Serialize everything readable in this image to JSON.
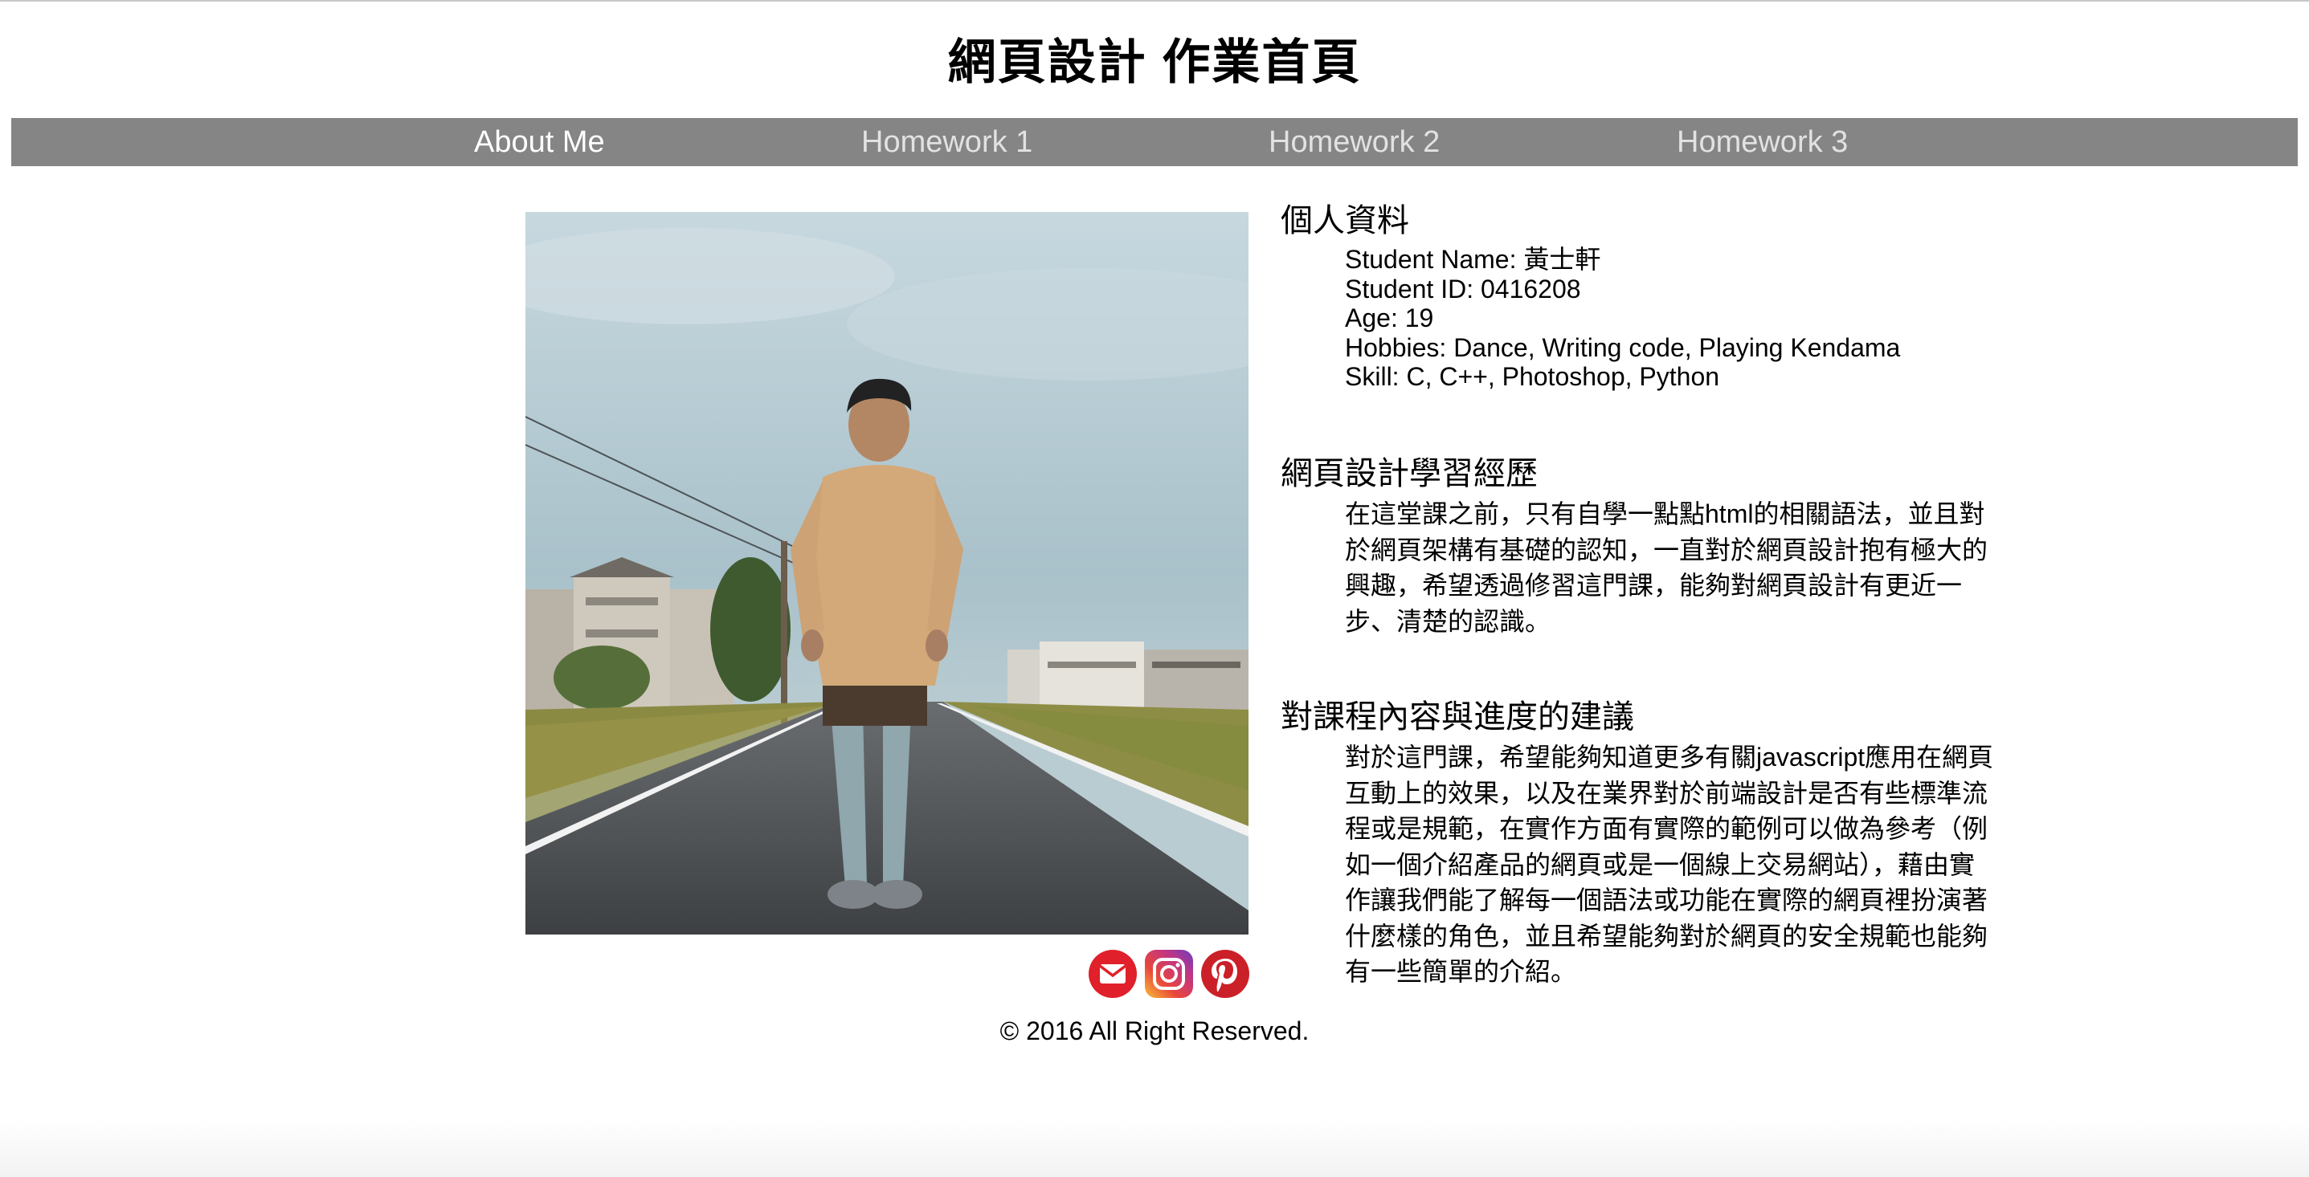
{
  "header": {
    "title": "網頁設計 作業首頁"
  },
  "nav": {
    "items": [
      {
        "label": "About Me",
        "active": true
      },
      {
        "label": "Homework 1",
        "active": false
      },
      {
        "label": "Homework 2",
        "active": false
      },
      {
        "label": "Homework 3",
        "active": false
      }
    ]
  },
  "profile_photo": {
    "icon": "profile-photo"
  },
  "social": [
    {
      "icon": "mail-icon",
      "color": "#e0202a"
    },
    {
      "icon": "instagram-icon",
      "color": "#c13584"
    },
    {
      "icon": "pinterest-icon",
      "color": "#cb2027"
    }
  ],
  "personal": {
    "heading": "個人資料",
    "lines": [
      "Student Name: 黃士軒",
      "Student ID: 0416208",
      "Age: 19",
      "Hobbies: Dance, Writing code, Playing Kendama",
      "Skill: C, C++, Photoshop, Python"
    ]
  },
  "history": {
    "heading": "網頁設計學習經歷",
    "text": "在這堂課之前，只有自學一點點html的相關語法，並且對於網頁架構有基礎的認知，一直對於網頁設計抱有極大的興趣，希望透過修習這門課，能夠對網頁設計有更近一步、清楚的認識。"
  },
  "suggestion": {
    "heading": "對課程內容與進度的建議",
    "text": "對於這門課，希望能夠知道更多有關javascript應用在網頁互動上的效果，以及在業界對於前端設計是否有些標準流程或是規範，在實作方面有實際的範例可以做為參考（例如一個介紹產品的網頁或是一個線上交易網站），藉由實作讓我們能了解每一個語法或功能在實際的網頁裡扮演著什麼樣的角色，並且希望能夠對於網頁的安全規範也能夠有一些簡單的介紹。"
  },
  "footer": {
    "text": "© 2016 All Right Reserved."
  },
  "colors": {
    "nav_background": "#858585",
    "nav_text": "#e2e2e2",
    "nav_active_text": "#ffffff"
  }
}
